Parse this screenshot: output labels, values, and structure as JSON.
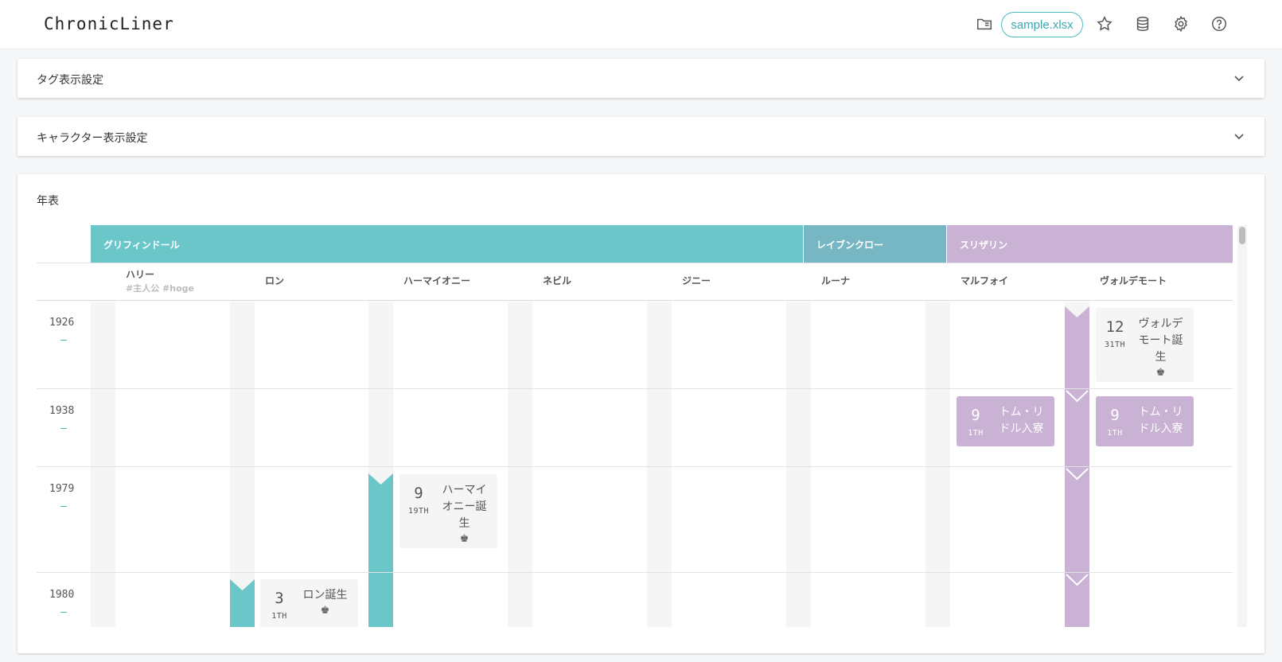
{
  "app": {
    "logo": "ChronicLiner",
    "file_name": "sample.xlsx"
  },
  "icons": [
    "folder-open-icon",
    "star-icon",
    "database-icon",
    "gear-icon",
    "help-circle-icon",
    "chevron-down-icon",
    "crown-icon"
  ],
  "panels": {
    "tags": {
      "title": "タグ表示設定"
    },
    "characters": {
      "title": "キャラクター表示設定"
    }
  },
  "timeline": {
    "title": "年表",
    "groups": [
      {
        "name": "グリフィンドール",
        "color": "#6bc6c9"
      },
      {
        "name": "レイブンクロー",
        "color": "#77b7c3"
      },
      {
        "name": "スリザリン",
        "color": "#c9b2d3"
      }
    ],
    "characters": [
      {
        "name": "ハリー",
        "tags": "#主人公 #hoge"
      },
      {
        "name": "ロン",
        "tags": ""
      },
      {
        "name": "ハーマイオニー",
        "tags": ""
      },
      {
        "name": "ネビル",
        "tags": ""
      },
      {
        "name": "ジニー",
        "tags": ""
      },
      {
        "name": "ルーナ",
        "tags": ""
      },
      {
        "name": "マルフォイ",
        "tags": ""
      },
      {
        "name": "ヴォルデモート",
        "tags": ""
      }
    ],
    "years": [
      "1926",
      "1938",
      "1979",
      "1980"
    ],
    "events": [
      {
        "character": "ヴォルデモート",
        "year": "1926",
        "month": "12",
        "day": "31TH",
        "text": "ヴォルデモート誕生"
      },
      {
        "character": "マルフォイ",
        "year": "1938",
        "month": "9",
        "day": "1TH",
        "text": "トム・リドル入寮"
      },
      {
        "character": "ヴォルデモート",
        "year": "1938",
        "month": "9",
        "day": "1TH",
        "text": "トム・リドル入寮"
      },
      {
        "character": "ハーマイオニー",
        "year": "1979",
        "month": "9",
        "day": "19TH",
        "text": "ハーマイオニー誕生"
      },
      {
        "character": "ロン",
        "year": "1980",
        "month": "3",
        "day": "1TH",
        "text": "ロン誕生"
      }
    ]
  }
}
